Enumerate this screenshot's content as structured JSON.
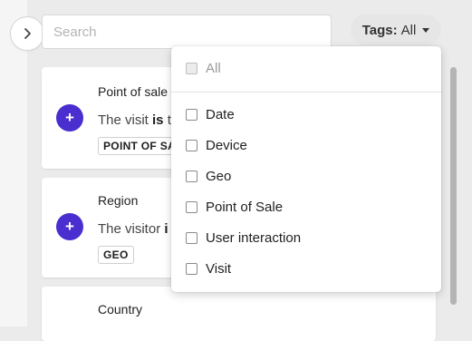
{
  "search": {
    "placeholder": "Search"
  },
  "tags": {
    "label": "Tags:",
    "value": "All"
  },
  "cards": [
    {
      "title": "Point of sale",
      "desc_prefix": "The visit ",
      "desc_bold": "is",
      "desc_suffix": " t",
      "badge": "POINT OF SA"
    },
    {
      "title": "Region",
      "desc_prefix": "The visitor ",
      "desc_bold": "i",
      "desc_suffix": "",
      "badge": "GEO"
    },
    {
      "title": "Country"
    }
  ],
  "dropdown": {
    "all_label": "All",
    "options": [
      "Date",
      "Device",
      "Geo",
      "Point of Sale",
      "User interaction",
      "Visit"
    ]
  },
  "colors": {
    "accent": "#4a2ecf",
    "background": "#ebebeb",
    "card": "#ffffff"
  },
  "icons": {
    "expand": "chevron-right-icon",
    "add": "plus-icon"
  }
}
